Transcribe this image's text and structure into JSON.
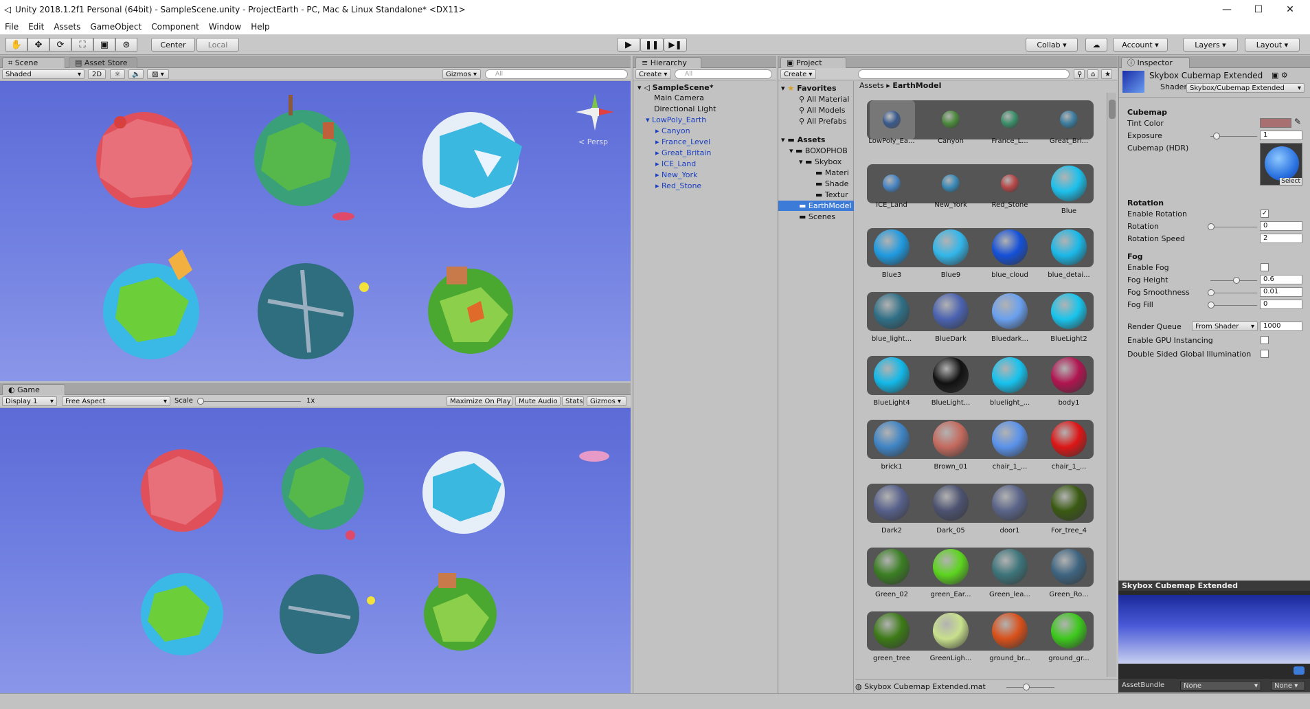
{
  "window": {
    "title": "Unity 2018.1.2f1 Personal (64bit) - SampleScene.unity - ProjectEarth - PC, Mac & Linux Standalone* <DX11>",
    "minimize_icon": "minimize-icon",
    "maximize_icon": "maximize-icon",
    "close_icon": "close-icon"
  },
  "menu": [
    "File",
    "Edit",
    "Assets",
    "GameObject",
    "Component",
    "Window",
    "Help"
  ],
  "toolbar": {
    "pivot_label": "Center",
    "space_label": "Local",
    "collab_label": "Collab",
    "account_label": "Account",
    "layers_label": "Layers",
    "layout_label": "Layout"
  },
  "scene": {
    "tab_label": "Scene",
    "store_tab_label": "Asset Store",
    "shading_mode": "Shaded",
    "mode_2d": "2D",
    "gizmos_label": "Gizmos",
    "search_placeholder": "All",
    "persp_label": "< Persp"
  },
  "game": {
    "tab_label": "Game",
    "display_label": "Display 1",
    "aspect_label": "Free Aspect",
    "scale_label": "Scale",
    "scale_value": "1x",
    "maximize_label": "Maximize On Play",
    "mute_label": "Mute Audio",
    "stats_label": "Stats",
    "gizmos_label": "Gizmos"
  },
  "hierarchy": {
    "tab_label": "Hierarchy",
    "create_label": "Create",
    "search_placeholder": "All",
    "scene_name": "SampleScene*",
    "items": [
      "Main Camera",
      "Directional Light",
      "LowPoly_Earth"
    ],
    "children": [
      "Canyon",
      "France_Level",
      "Great_Britain",
      "ICE_Land",
      "New_York",
      "Red_Stone"
    ]
  },
  "project": {
    "tab_label": "Project",
    "create_label": "Create",
    "favorites_label": "Favorites",
    "favorites": [
      "All Material",
      "All Models",
      "All Prefabs"
    ],
    "assets_label": "Assets",
    "tree": [
      "BOXOPHOB",
      "Skybox",
      "Materi",
      "Shade",
      "Textur",
      "EarthModel",
      "Scenes"
    ],
    "breadcrumb_root": "Assets",
    "breadcrumb_current": "EarthModel",
    "footer_file": "Skybox Cubemap Extended.mat",
    "asset_rows": [
      [
        {
          "name": "LowPoly_Ea...",
          "color": "#3a5a8c"
        },
        {
          "name": "Canyon",
          "color": "#4c8a3c"
        },
        {
          "name": "France_L...",
          "color": "#3c8f6a"
        },
        {
          "name": "Great_Bri...",
          "color": "#3c7ea0"
        }
      ],
      [
        {
          "name": "ICE_Land",
          "color": "#4a86c4"
        },
        {
          "name": "New_York",
          "color": "#3a8ab8"
        },
        {
          "name": "Red_Stone",
          "color": "#b84848"
        },
        {
          "name": "Blue",
          "color": "#1cc0ec"
        }
      ],
      [
        {
          "name": "Blue3",
          "color": "#1f9ae0"
        },
        {
          "name": "Blue9",
          "color": "#32b6ea"
        },
        {
          "name": "blue_cloud",
          "color": "#1450d8"
        },
        {
          "name": "blue_detai...",
          "color": "#1ab8e8"
        }
      ],
      [
        {
          "name": "blue_light...",
          "color": "#2f6f86"
        },
        {
          "name": "BlueDark",
          "color": "#4a62b0"
        },
        {
          "name": "Bluedark...",
          "color": "#6aa0ee"
        },
        {
          "name": "BlueLight2",
          "color": "#18c4ec"
        }
      ],
      [
        {
          "name": "BlueLight4",
          "color": "#12b8e8"
        },
        {
          "name": "BlueLight...",
          "color": "#111111"
        },
        {
          "name": "bluelight_...",
          "color": "#16c2ee"
        },
        {
          "name": "body1",
          "color": "#b01450"
        }
      ],
      [
        {
          "name": "brick1",
          "color": "#3f84c4"
        },
        {
          "name": "Brown_01",
          "color": "#c46a5e"
        },
        {
          "name": "chair_1_...",
          "color": "#5a92ea"
        },
        {
          "name": "chair_1_...",
          "color": "#dc1616"
        }
      ],
      [
        {
          "name": "Dark2",
          "color": "#56608a"
        },
        {
          "name": "Dark_05",
          "color": "#4c5270"
        },
        {
          "name": "door1",
          "color": "#5a6488"
        },
        {
          "name": "For_tree_4",
          "color": "#3a5a12"
        }
      ],
      [
        {
          "name": "Green_02",
          "color": "#3a7e22"
        },
        {
          "name": "green_Ear...",
          "color": "#5cd41e"
        },
        {
          "name": "Green_lea...",
          "color": "#3c747a"
        },
        {
          "name": "Green_Ro...",
          "color": "#3e6480"
        }
      ],
      [
        {
          "name": "green_tree",
          "color": "#3c7a16"
        },
        {
          "name": "GreenLigh...",
          "color": "#c8e08c"
        },
        {
          "name": "ground_br...",
          "color": "#d8501a"
        },
        {
          "name": "ground_gr...",
          "color": "#3cc81c"
        }
      ]
    ]
  },
  "inspector": {
    "tab_label": "Inspector",
    "material_name": "Skybox Cubemap Extended",
    "shader_label": "Shader",
    "shader_value": "Skybox/Cubemap Extended",
    "cubemap_header": "Cubemap",
    "tint_label": "Tint Color",
    "tint_color": "#a87070",
    "exposure_label": "Exposure",
    "exposure_value": "1",
    "cubemap_hdr_label": "Cubemap (HDR)",
    "select_label": "Select",
    "rotation_header": "Rotation",
    "enable_rotation_label": "Enable Rotation",
    "rotation_label": "Rotation",
    "rotation_value": "0",
    "rotation_speed_label": "Rotation Speed",
    "rotation_speed_value": "2",
    "fog_header": "Fog",
    "enable_fog_label": "Enable Fog",
    "fog_height_label": "Fog Height",
    "fog_height_value": "0.6",
    "fog_smooth_label": "Fog Smoothness",
    "fog_smooth_value": "0.01",
    "fog_fill_label": "Fog Fill",
    "fog_fill_value": "0",
    "render_queue_label": "Render Queue",
    "render_queue_mode": "From Shader",
    "render_queue_value": "1000",
    "gpu_inst_label": "Enable GPU Instancing",
    "double_sided_label": "Double Sided Global Illumination",
    "preview_title": "Skybox Cubemap Extended",
    "assetbundle_label": "AssetBundle",
    "assetbundle_value": "None",
    "assetbundle_variant": "None"
  }
}
